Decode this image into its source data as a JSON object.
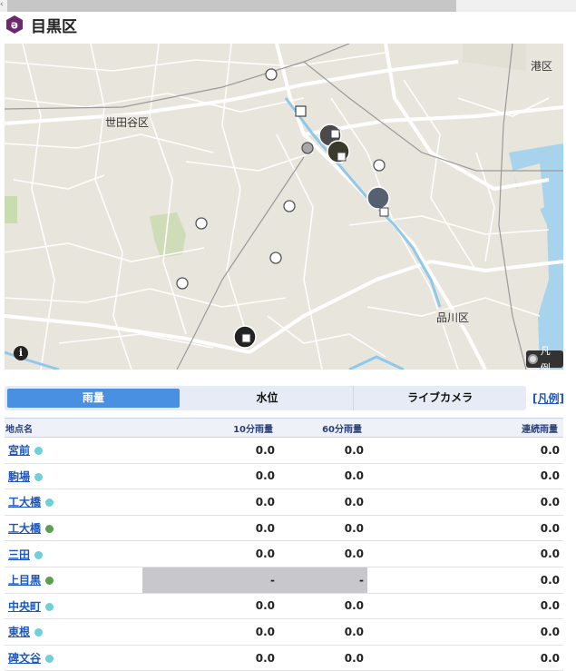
{
  "app": {
    "ward_title": "目黒区"
  },
  "map": {
    "labels": {
      "setagaya": "世田谷区",
      "minato": "港区",
      "shinagawa": "品川区"
    },
    "info_icon": "i",
    "legend_button": "凡例"
  },
  "tabs": [
    {
      "label": "雨量",
      "active": true
    },
    {
      "label": "水位",
      "active": false
    },
    {
      "label": "ライブカメラ",
      "active": false
    }
  ],
  "legend_link": "[凡例]",
  "table": {
    "headers": {
      "name": "地点名",
      "m10": "10分雨量",
      "m60": "60分雨量",
      "cont": "連続雨量"
    },
    "rows": [
      {
        "name": "宮前",
        "status_color": "#6fd0d8",
        "m10": "0.0",
        "m60": "0.0",
        "cont": "0.0"
      },
      {
        "name": "駒場",
        "status_color": "#6fd0d8",
        "m10": "0.0",
        "m60": "0.0",
        "cont": "0.0"
      },
      {
        "name": "工大橋",
        "status_color": "#6fd0d8",
        "m10": "0.0",
        "m60": "0.0",
        "cont": "0.0"
      },
      {
        "name": "工大橋",
        "status_color": "#5a9e4f",
        "m10": "0.0",
        "m60": "0.0",
        "cont": "0.0"
      },
      {
        "name": "三田",
        "status_color": "#6fd0d8",
        "m10": "0.0",
        "m60": "0.0",
        "cont": "0.0"
      },
      {
        "name": "上目黒",
        "status_color": "#5a9e4f",
        "m10": "-",
        "m60": "-",
        "cont": "0.0"
      },
      {
        "name": "中央町",
        "status_color": "#6fd0d8",
        "m10": "0.0",
        "m60": "0.0",
        "cont": "0.0"
      },
      {
        "name": "東根",
        "status_color": "#6fd0d8",
        "m10": "0.0",
        "m60": "0.0",
        "cont": "0.0"
      },
      {
        "name": "碑文谷",
        "status_color": "#6fd0d8",
        "m10": "0.0",
        "m60": "0.0",
        "cont": "0.0"
      }
    ]
  }
}
